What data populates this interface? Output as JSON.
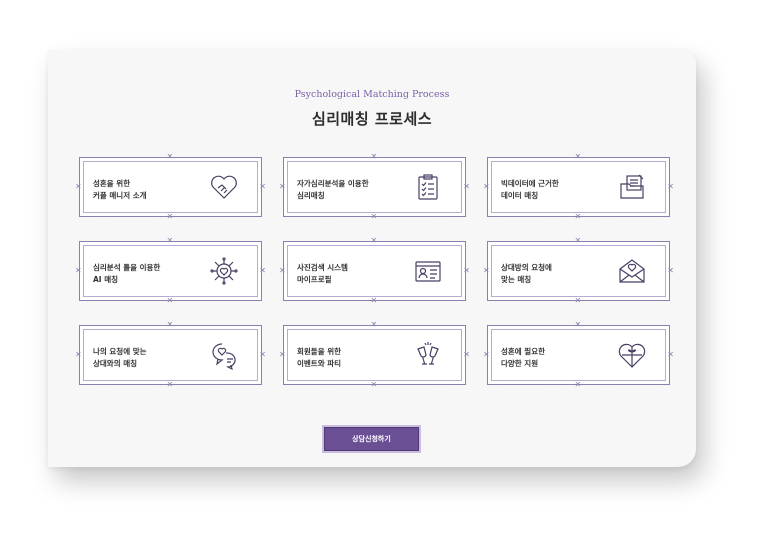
{
  "header": {
    "subtitle": "Psychological Matching Process",
    "title": "심리매칭 프로세스"
  },
  "process_items": [
    {
      "text": "성혼을 위한\n커플 매니저 소개",
      "icon": "handshake-heart-icon"
    },
    {
      "text": "자가심리분석을 이용한\n심리매칭",
      "icon": "clipboard-checklist-icon"
    },
    {
      "text": "빅데이터에 근거한\n데이터 매칭",
      "icon": "document-folder-icon"
    },
    {
      "text": "심리분석 툴을 이용한\nAI 매칭",
      "icon": "ai-chip-heart-icon"
    },
    {
      "text": "사진검색 시스템\n마이프로필",
      "icon": "profile-card-icon"
    },
    {
      "text": "상대방의 요청에\n맞는 매칭",
      "icon": "envelope-heart-icon"
    },
    {
      "text": "나의 요청에 맞는\n상대와의 매칭",
      "icon": "chat-bubble-heart-icon"
    },
    {
      "text": "회원들을 위한\n이벤트와 파티",
      "icon": "champagne-glasses-icon"
    },
    {
      "text": "성혼에 필요한\n다양한 지원",
      "icon": "gift-heart-icon"
    }
  ],
  "cta": {
    "label": "상담신청하기"
  },
  "colors": {
    "accent": "#6a4f95",
    "border": "#8c7fae",
    "subtitle": "#7b62a8"
  }
}
